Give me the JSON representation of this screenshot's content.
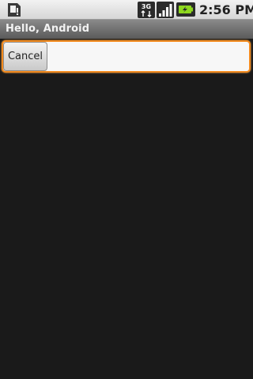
{
  "status_bar": {
    "time": "2:56 PM",
    "network_label": "3G",
    "icons": [
      "sd-card-icon",
      "3g-data-icon",
      "signal-strength-icon",
      "battery-charging-icon"
    ]
  },
  "title_bar": {
    "title": "Hello, Android"
  },
  "search_row": {
    "cancel_label": "Cancel",
    "input_value": ""
  },
  "colors": {
    "focus_border": "#f28a1e",
    "background": "#1a1a1a",
    "title_bar": "#6e6e6e"
  }
}
